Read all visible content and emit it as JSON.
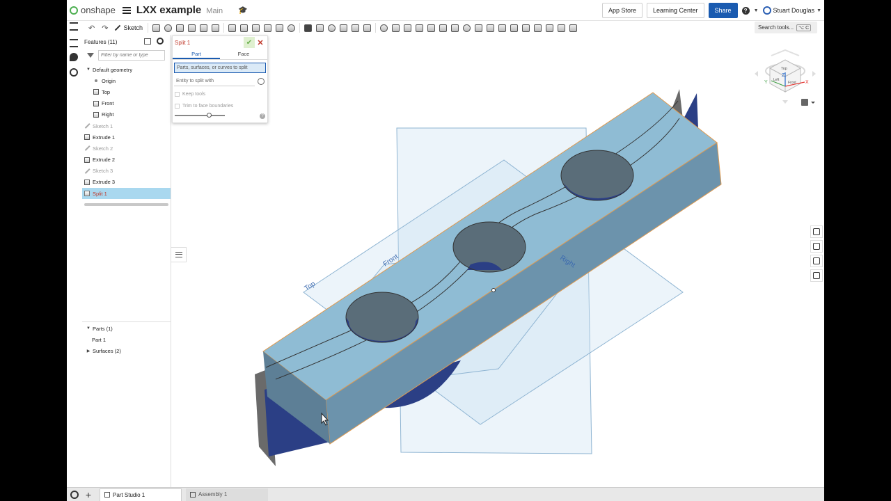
{
  "app": {
    "brand": "onshape",
    "doc_title": "LXX example",
    "branch": "Main"
  },
  "header": {
    "app_store": "App Store",
    "learning_center": "Learning Center",
    "share": "Share",
    "help": "?",
    "user_name": "Stuart Douglas"
  },
  "toolbar": {
    "sketch_label": "Sketch",
    "search_placeholder": "Search tools...",
    "search_shortcut": "⌥ C"
  },
  "features": {
    "title": "Features (11)",
    "filter_placeholder": "Filter by name or type",
    "items": [
      {
        "label": "Default geometry",
        "icon": "chevron-down"
      },
      {
        "label": "Origin",
        "icon": "origin-icon"
      },
      {
        "label": "Top",
        "icon": "plane-icon"
      },
      {
        "label": "Front",
        "icon": "plane-icon"
      },
      {
        "label": "Right",
        "icon": "plane-icon"
      },
      {
        "label": "Sketch 1",
        "icon": "sketch-icon"
      },
      {
        "label": "Extrude 1",
        "icon": "extrude-icon"
      },
      {
        "label": "Sketch 2",
        "icon": "sketch-icon"
      },
      {
        "label": "Extrude 2",
        "icon": "extrude-icon"
      },
      {
        "label": "Sketch 3",
        "icon": "sketch-icon"
      },
      {
        "label": "Extrude 3",
        "icon": "extrude-icon"
      },
      {
        "label": "Split 1",
        "icon": "split-icon"
      }
    ],
    "parts_header": "Parts (1)",
    "part_item": "Part 1",
    "surfaces_header": "Surfaces (2)"
  },
  "dialog": {
    "title": "Split 1",
    "tab_part": "Part",
    "tab_face": "Face",
    "field_parts": "Parts, surfaces, or curves to split",
    "field_entity": "Entity to split with",
    "check_keep_tools": "Keep tools",
    "check_trim": "Trim to face boundaries",
    "help": "?"
  },
  "viewport": {
    "plane_labels": {
      "top": "Top",
      "front": "Front",
      "right": "Right"
    },
    "view_cube": {
      "top": "Top",
      "front": "Front",
      "left": "Left"
    },
    "axes": {
      "x": "X",
      "y": "Y",
      "z": "Z"
    },
    "colors": {
      "body_top": "#8fbcd4",
      "body_front": "#6c93ac",
      "body_side": "#5d7f96",
      "surface_dark": "#2b3f85",
      "plane_fill": "#c9dff0",
      "plane_stroke": "#8eb4d2",
      "edge_highlight": "#e09a4f"
    }
  },
  "tabs": [
    {
      "label": "Part Studio 1",
      "active": true
    },
    {
      "label": "Assembly 1",
      "active": false
    }
  ]
}
